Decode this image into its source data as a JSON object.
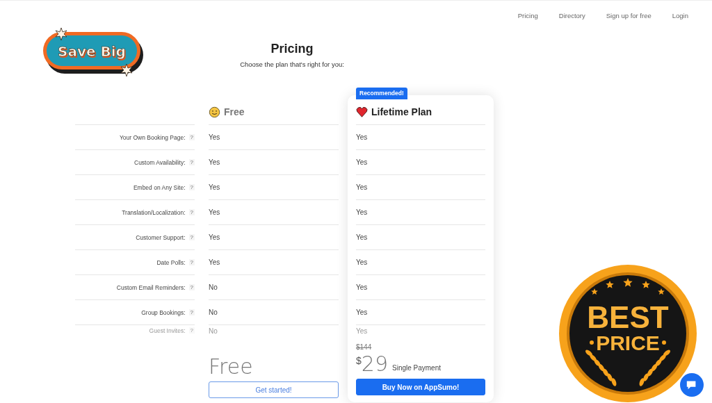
{
  "nav": [
    {
      "label": "Pricing"
    },
    {
      "label": "Directory"
    },
    {
      "label": "Sign up for free"
    },
    {
      "label": "Login"
    }
  ],
  "logo": {
    "text": "Save Big"
  },
  "header": {
    "title": "Pricing",
    "subtitle": "Choose the plan that's right for you:"
  },
  "plans": [
    {
      "name": "Free",
      "recommended": false,
      "price": "Free",
      "button": "Get started!"
    },
    {
      "name": "Lifetime Plan",
      "recommended": true,
      "badge": "Recommended!",
      "old_price": "$144",
      "currency": "$",
      "price": "29",
      "price_note": "Single Payment",
      "button": "Buy Now on AppSumo!"
    }
  ],
  "features": [
    {
      "label": "Your Own Booking Page:",
      "hint": "?",
      "values": [
        "Yes",
        "Yes"
      ],
      "faded": false
    },
    {
      "label": "Custom Availability:",
      "hint": "?",
      "values": [
        "Yes",
        "Yes"
      ],
      "faded": false
    },
    {
      "label": "Embed on Any Site:",
      "hint": "?",
      "values": [
        "Yes",
        "Yes"
      ],
      "faded": false
    },
    {
      "label": "Translation/Localization:",
      "hint": "?",
      "values": [
        "Yes",
        "Yes"
      ],
      "faded": false
    },
    {
      "label": "Customer Support:",
      "hint": "?",
      "values": [
        "Yes",
        "Yes"
      ],
      "faded": false
    },
    {
      "label": "Date Polls:",
      "hint": "?",
      "values": [
        "Yes",
        "Yes"
      ],
      "faded": false
    },
    {
      "label": "Custom Email Reminders:",
      "hint": "?",
      "values": [
        "No",
        "Yes"
      ],
      "faded": false
    },
    {
      "label": "Group Bookings:",
      "hint": "?",
      "values": [
        "No",
        "Yes"
      ],
      "faded": false
    },
    {
      "label": "Guest Invites:",
      "hint": "?",
      "values": [
        "No",
        "Yes"
      ],
      "faded": true
    }
  ],
  "sticker": {
    "line_1": "BEST",
    "line_2": "PRICE"
  }
}
